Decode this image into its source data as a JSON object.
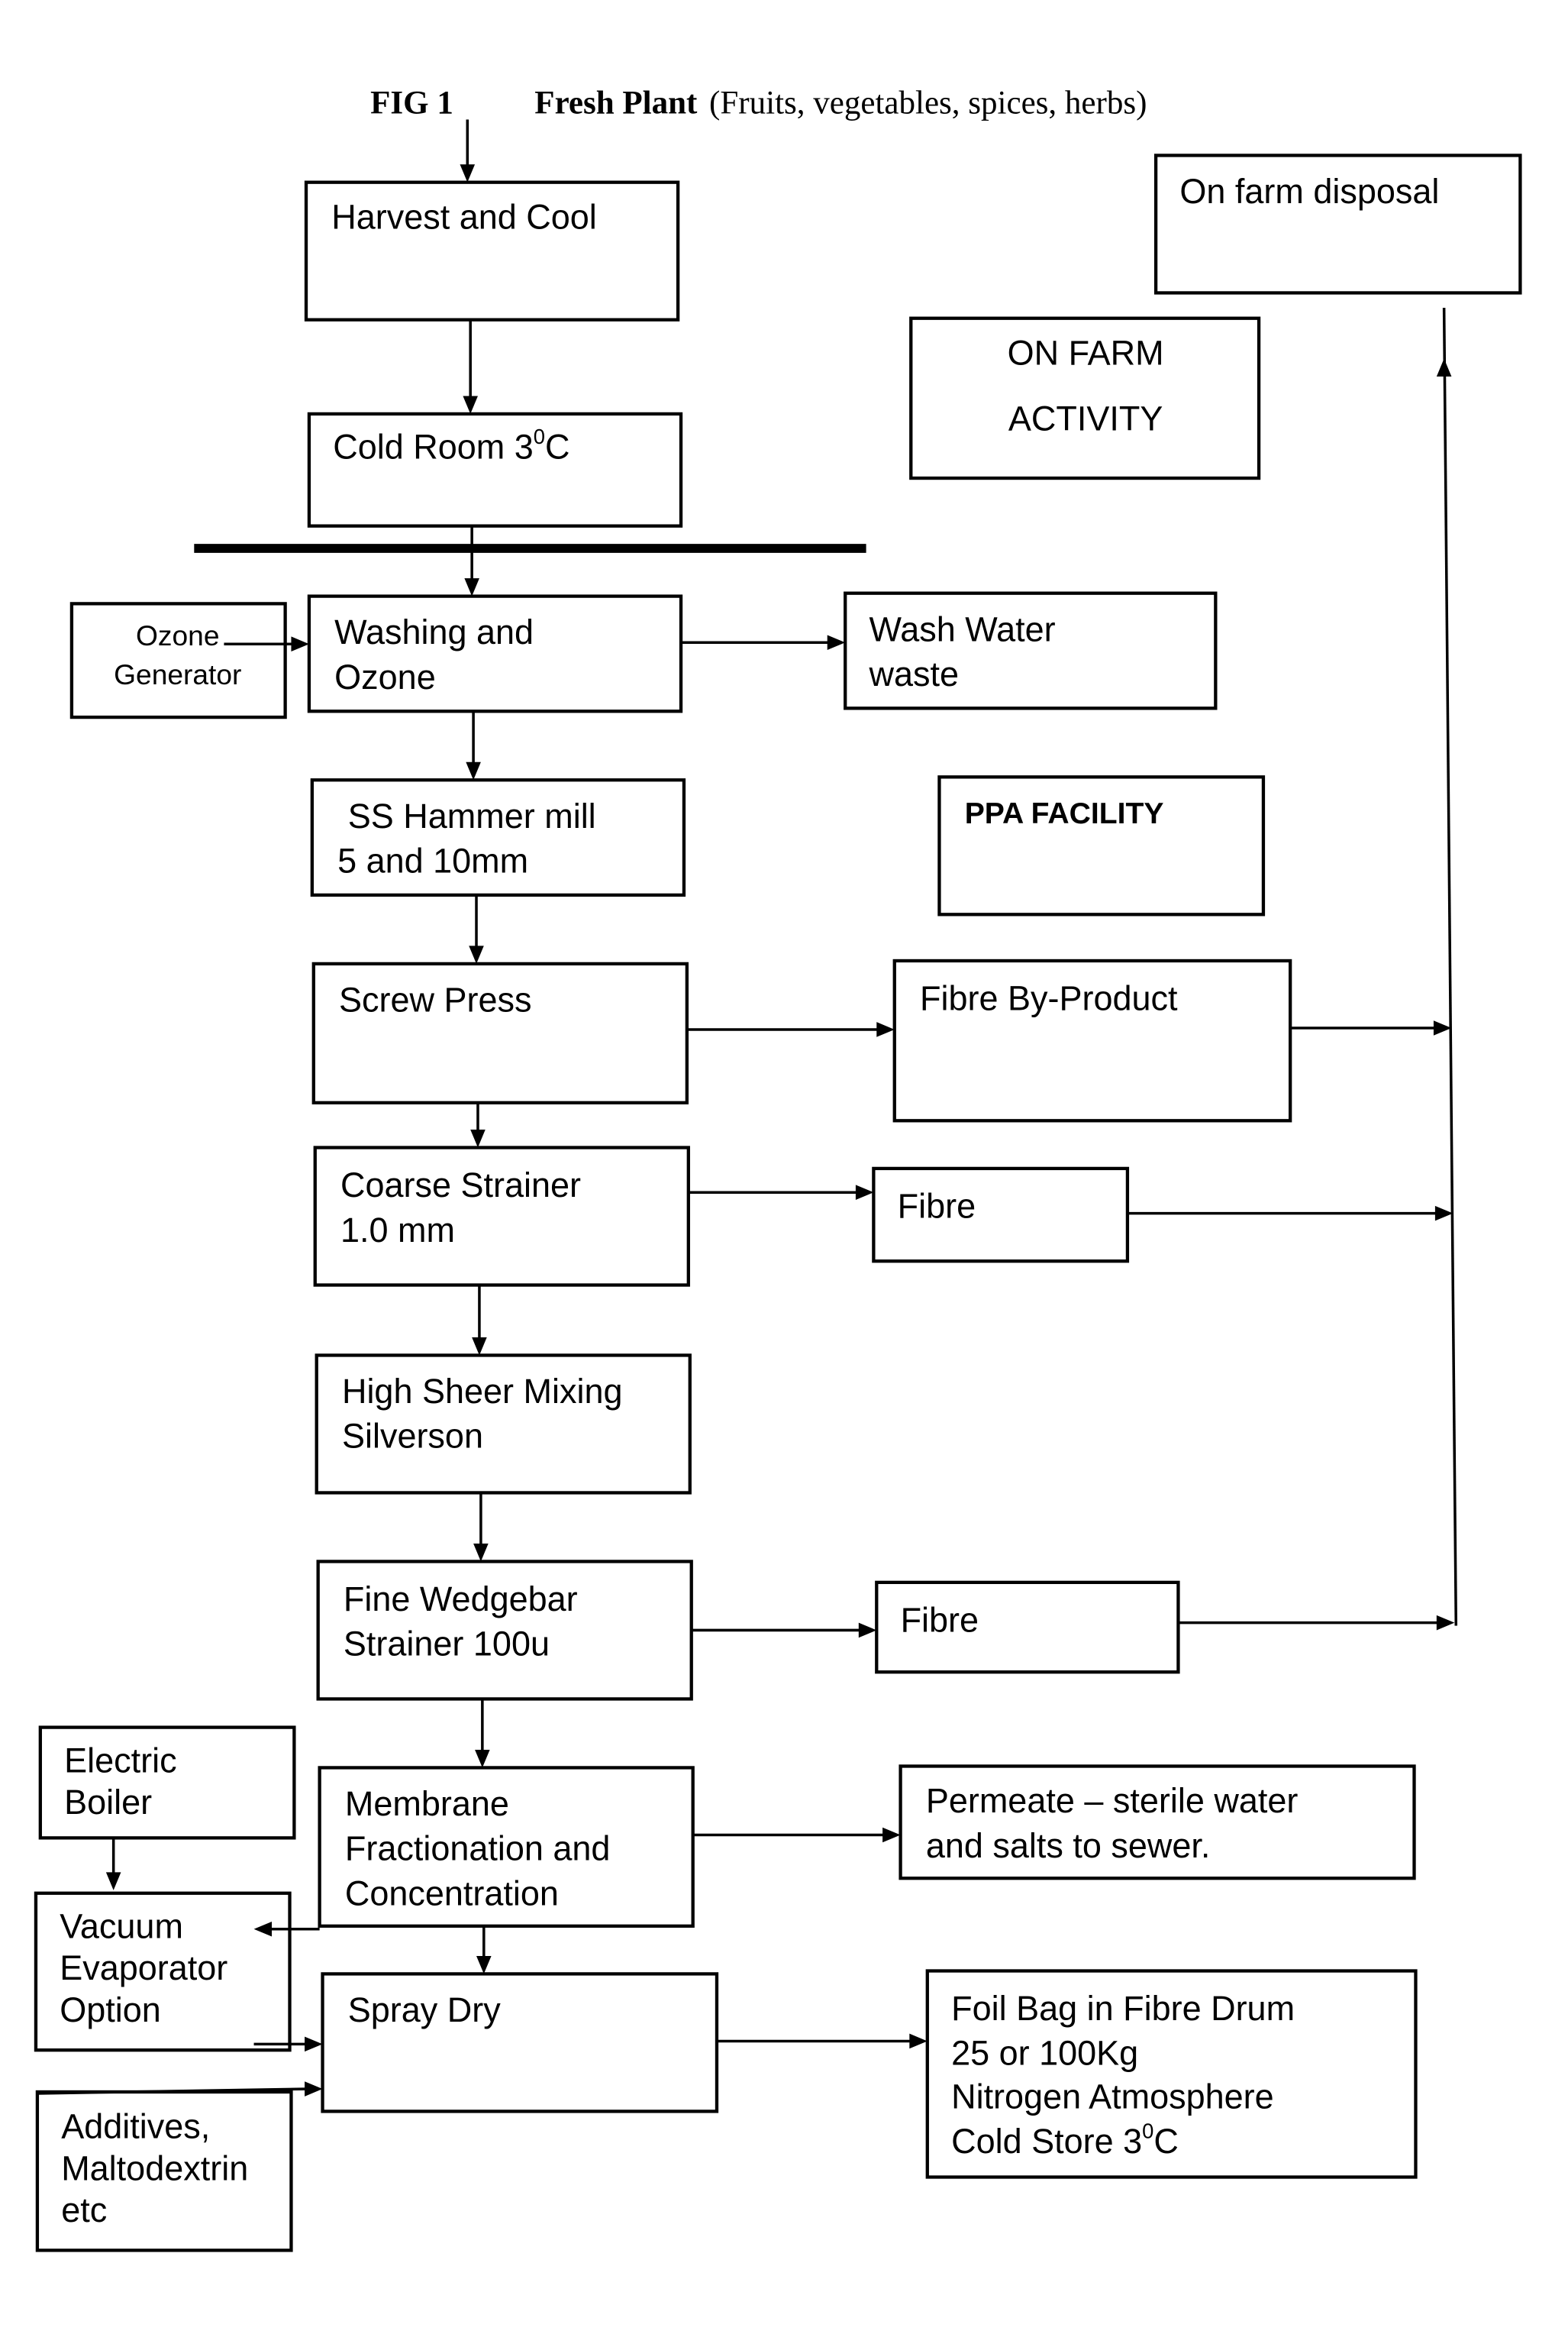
{
  "figure": {
    "label": "FIG 1",
    "title_bold": "Fresh Plant",
    "title_rest": "(Fruits, vegetables, spices, herbs)"
  },
  "sections": {
    "on_farm": [
      "ON FARM",
      "ACTIVITY"
    ],
    "facility": "PPA FACILITY"
  },
  "nodes": {
    "harvest": [
      "Harvest and Cool"
    ],
    "cold_room": {
      "text": "Cold Room 3",
      "sup": "0",
      "unit": "C"
    },
    "ozone_generator": [
      "Ozone",
      "Generator"
    ],
    "washing": [
      "Washing and",
      "Ozone"
    ],
    "wash_water": [
      "Wash Water",
      "waste"
    ],
    "hammer_mill": [
      "SS Hammer mill",
      "5 and 10mm"
    ],
    "screw_press": [
      "Screw Press"
    ],
    "fibre_byproduct": [
      "Fibre By-Product"
    ],
    "coarse_strainer": [
      "Coarse Strainer",
      "1.0 mm"
    ],
    "fibre_1": [
      "Fibre"
    ],
    "high_shear": [
      "High Sheer Mixing",
      "Silverson"
    ],
    "fine_strainer": [
      "Fine Wedgebar",
      "Strainer 100u"
    ],
    "fibre_2": [
      "Fibre"
    ],
    "on_farm_disposal": [
      "On farm disposal"
    ],
    "electric_boiler": [
      "Electric",
      "Boiler"
    ],
    "membrane": [
      "Membrane",
      "Fractionation and",
      "Concentration"
    ],
    "permeate": [
      "Permeate – sterile water",
      "and salts to sewer."
    ],
    "vacuum_evaporator": [
      "Vacuum",
      "Evaporator",
      "Option"
    ],
    "spray_dry": [
      "Spray Dry"
    ],
    "additives": [
      "Additives,",
      "Maltodextrin",
      "etc"
    ],
    "foil_bag": {
      "lines": [
        "Foil Bag in Fibre Drum",
        "25 or 100Kg",
        "Nitrogen Atmosphere"
      ],
      "last_text": "Cold Store 3",
      "last_sup": "0",
      "last_unit": "C"
    }
  },
  "edges": [
    {
      "from": "Fresh Plant",
      "to": "harvest"
    },
    {
      "from": "harvest",
      "to": "cold_room"
    },
    {
      "from": "cold_room",
      "to": "washing"
    },
    {
      "from": "ozone_generator",
      "to": "washing"
    },
    {
      "from": "washing",
      "to": "wash_water"
    },
    {
      "from": "washing",
      "to": "hammer_mill"
    },
    {
      "from": "hammer_mill",
      "to": "screw_press"
    },
    {
      "from": "screw_press",
      "to": "fibre_byproduct"
    },
    {
      "from": "screw_press",
      "to": "coarse_strainer"
    },
    {
      "from": "coarse_strainer",
      "to": "fibre_1"
    },
    {
      "from": "coarse_strainer",
      "to": "high_shear"
    },
    {
      "from": "high_shear",
      "to": "fine_strainer"
    },
    {
      "from": "fine_strainer",
      "to": "fibre_2"
    },
    {
      "from": "fine_strainer",
      "to": "membrane"
    },
    {
      "from": "fibre_byproduct",
      "to": "on_farm_disposal"
    },
    {
      "from": "fibre_1",
      "to": "on_farm_disposal"
    },
    {
      "from": "fibre_2",
      "to": "on_farm_disposal"
    },
    {
      "from": "membrane",
      "to": "permeate"
    },
    {
      "from": "membrane",
      "to": "vacuum_evaporator"
    },
    {
      "from": "membrane",
      "to": "spray_dry"
    },
    {
      "from": "electric_boiler",
      "to": "vacuum_evaporator"
    },
    {
      "from": "vacuum_evaporator",
      "to": "spray_dry"
    },
    {
      "from": "additives",
      "to": "spray_dry"
    },
    {
      "from": "spray_dry",
      "to": "foil_bag"
    }
  ]
}
